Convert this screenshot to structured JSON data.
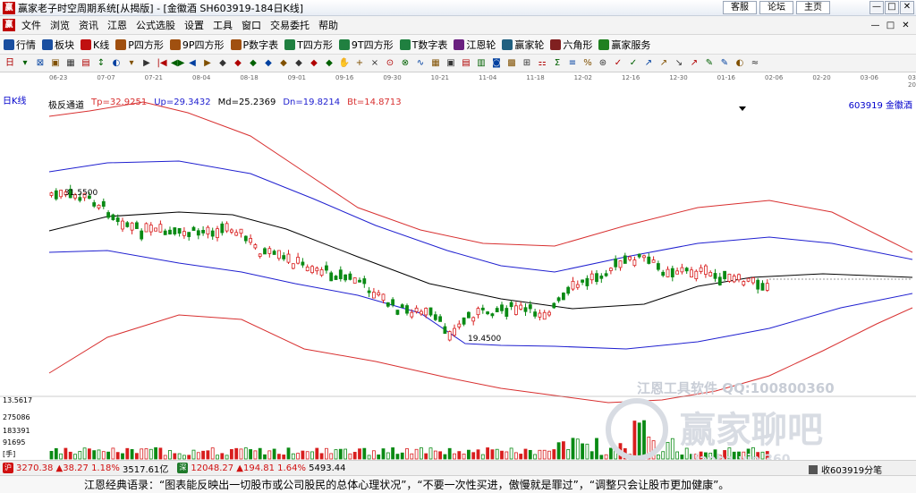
{
  "window": {
    "title": "赢家老子时空周期系统[从揭版] - [金徽酒  SH603919-184日K线]",
    "app_icon": "赢",
    "links": [
      "客服",
      "论坛",
      "主页"
    ],
    "controls": [
      "—",
      "□",
      "✕"
    ]
  },
  "menu": {
    "items": [
      "文件",
      "浏览",
      "资讯",
      "江恩",
      "公式选股",
      "设置",
      "工具",
      "窗口",
      "交易委托",
      "帮助"
    ],
    "right_controls": [
      "—",
      "□",
      "✕"
    ]
  },
  "toolbar1": [
    {
      "label": "行情",
      "icon": "grid-icon",
      "color": "#1a4fa0"
    },
    {
      "label": "板块",
      "icon": "blocks-icon",
      "color": "#1a4fa0"
    },
    {
      "label": "K线",
      "icon": "candle-icon",
      "color": "#c01010"
    },
    {
      "label": "P四方形",
      "icon": "square-icon",
      "color": "#a05010"
    },
    {
      "label": "9P四方形",
      "icon": "square-icon",
      "color": "#a05010"
    },
    {
      "label": "P数字表",
      "icon": "table-icon",
      "color": "#a05010"
    },
    {
      "label": "T四方形",
      "icon": "square-icon",
      "color": "#208040"
    },
    {
      "label": "9T四方形",
      "icon": "square-icon",
      "color": "#208040"
    },
    {
      "label": "T数字表",
      "icon": "table-icon",
      "color": "#208040"
    },
    {
      "label": "江恩轮",
      "icon": "wheel-icon",
      "color": "#6a2080"
    },
    {
      "label": "赢家轮",
      "icon": "wheel-icon",
      "color": "#206080"
    },
    {
      "label": "六角形",
      "icon": "hexagon-icon",
      "color": "#802020"
    },
    {
      "label": "赢家服务",
      "icon": "dollar-icon",
      "color": "#208020"
    }
  ],
  "toolbar2": [
    "日",
    "▾",
    "⊠",
    "▣",
    "▦",
    "▤",
    "↕",
    "◐",
    "▾",
    "▶",
    "|◀",
    "◀▶",
    "◀",
    "▶",
    "◆",
    "◆",
    "◆",
    "◆",
    "◆",
    "◆",
    "◆",
    "◆",
    "✋",
    "+",
    "×",
    "⊙",
    "⊗",
    "∿",
    "▦",
    "▣",
    "▤",
    "▥",
    "◙",
    "▩",
    "⊞",
    "⚏",
    "Σ",
    "≡",
    "%",
    "⊛",
    "✓",
    "✓",
    "↗",
    "↗",
    "↘",
    "↗",
    "✎",
    "✎",
    "◐",
    "≈"
  ],
  "chart": {
    "period_label": "日K线",
    "indicator_name": "极反通道",
    "tp": "Tp=32.9251",
    "up": "Up=29.3432",
    "md": "Md=25.2369",
    "dn": "Dn=19.8214",
    "bt": "Bt=14.8713",
    "stock": "603919  金徽酒",
    "high_marker": "31.5500",
    "low_marker": "19.4500",
    "date_ticks": [
      "06-23",
      "07-07",
      "07-21",
      "08-04",
      "08-18",
      "09-01",
      "09-16",
      "09-30",
      "10-21",
      "11-04",
      "11-18",
      "12-02",
      "12-16",
      "12-30",
      "01-16",
      "02-06",
      "02-20",
      "03-06",
      "03-20"
    ],
    "volume_axis": [
      "13.5617",
      "275086",
      "183391",
      "91695",
      "[手]"
    ],
    "watermark_line1": "江恩工具软件  QQ:100800360",
    "watermark_line2": "赢家聊吧",
    "watermark_line3": "liaoba.vip 360"
  },
  "status": {
    "sh_icon": "沪",
    "sh_index": "3270.38",
    "sh_change": "▲38.27",
    "sh_pct": "1.18%",
    "sh_amount": "3517.61亿",
    "sz_icon": "深",
    "sz_index": "12048.27",
    "sz_change": "▲194.81",
    "sz_pct": "1.64%",
    "sz_amount": "5493.44",
    "right_text": "收603919分笔"
  },
  "quote": "江恩经典语录：“图表能反映出一切股市或公司股民的总体心理状况”，“不要一次性买进，傲慢就是罪过”，“调整只会让股市更加健康”。",
  "colors": {
    "up_candle": "#d81e1e",
    "down_candle": "#0a8a14",
    "outer_band": "#d83030",
    "inner_band": "#2020d0",
    "mid_line": "#000000"
  },
  "chart_data": {
    "type": "candlestick",
    "title": "",
    "series": [
      {
        "name": "Tp",
        "last": 32.9251
      },
      {
        "name": "Up",
        "last": 29.3432
      },
      {
        "name": "Md",
        "last": 25.2369
      },
      {
        "name": "Dn",
        "last": 19.8214
      },
      {
        "name": "Bt",
        "last": 14.8713
      }
    ],
    "price_high": 31.55,
    "price_low": 19.45,
    "volume_ticks": [
      91695,
      183391,
      275086
    ]
  }
}
